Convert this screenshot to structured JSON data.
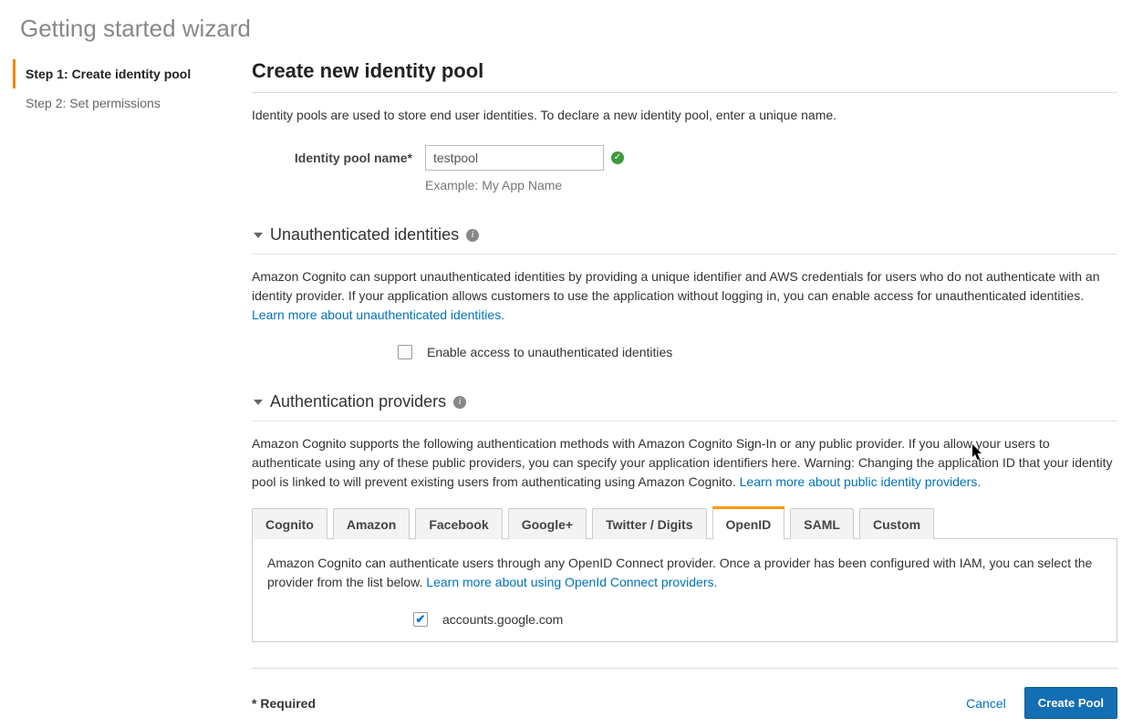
{
  "page_title": "Getting started wizard",
  "sidebar": {
    "steps": [
      {
        "label": "Step 1: Create identity pool",
        "active": true
      },
      {
        "label": "Step 2: Set permissions",
        "active": false
      }
    ]
  },
  "main": {
    "title": "Create new identity pool",
    "description": "Identity pools are used to store end user identities. To declare a new identity pool, enter a unique name.",
    "pool_name": {
      "label": "Identity pool name*",
      "value": "testpool",
      "example": "Example: My App Name"
    }
  },
  "section_unauth": {
    "title": "Unauthenticated identities",
    "text": "Amazon Cognito can support unauthenticated identities by providing a unique identifier and AWS credentials for users who do not authenticate with an identity provider. If your application allows customers to use the application without logging in, you can enable access for unauthenticated identities. ",
    "link": "Learn more about unauthenticated identities.",
    "checkbox_label": "Enable access to unauthenticated identities",
    "checkbox_checked": false
  },
  "section_auth": {
    "title": "Authentication providers",
    "text": "Amazon Cognito supports the following authentication methods with Amazon Cognito Sign-In or any public provider. If you allow your users to authenticate using any of these public providers, you can specify your application identifiers here. Warning: Changing the application ID that your identity pool is linked to will prevent existing users from authenticating using Amazon Cognito. ",
    "link": "Learn more about public identity providers.",
    "tabs": [
      "Cognito",
      "Amazon",
      "Facebook",
      "Google+",
      "Twitter / Digits",
      "OpenID",
      "SAML",
      "Custom"
    ],
    "active_tab": "OpenID",
    "openid_panel": {
      "text": "Amazon Cognito can authenticate users through any OpenID Connect provider. Once a provider has been configured with IAM, you can select the provider from the list below. ",
      "link": "Learn more about using OpenId Connect providers.",
      "provider": "accounts.google.com",
      "provider_checked": true
    }
  },
  "footer": {
    "required_note": "* Required",
    "cancel": "Cancel",
    "create": "Create Pool"
  }
}
